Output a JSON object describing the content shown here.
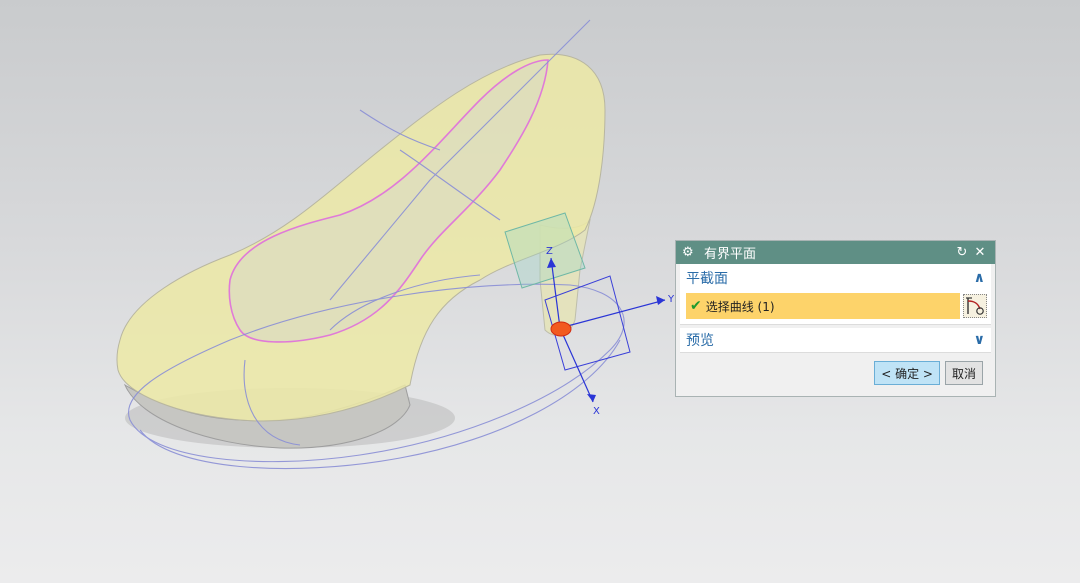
{
  "viewport": {
    "axes": {
      "x_label": "X",
      "y_label": "Y",
      "z_label": "Z"
    }
  },
  "dialog": {
    "title": "有界平面",
    "reset_icon": "↻",
    "close_icon": "✕",
    "section_plane": {
      "label": "平截面",
      "collapse_icon": "∧"
    },
    "select_curve": {
      "check_icon": "✔",
      "label": "选择曲线 (1)"
    },
    "section_preview": {
      "label": "预览",
      "expand_icon": "∨"
    },
    "ok_label": "< 确定 >",
    "cancel_label": "取消"
  },
  "colors": {
    "title_bar": "#5f8f85",
    "section_text": "#2a6ca8",
    "selection_highlight": "#fdd36a",
    "shoe_fill": "#ece9a6",
    "sole": "#bdbdbd",
    "curve": "#8a8fd6",
    "edge_highlight": "#e07ad8"
  }
}
